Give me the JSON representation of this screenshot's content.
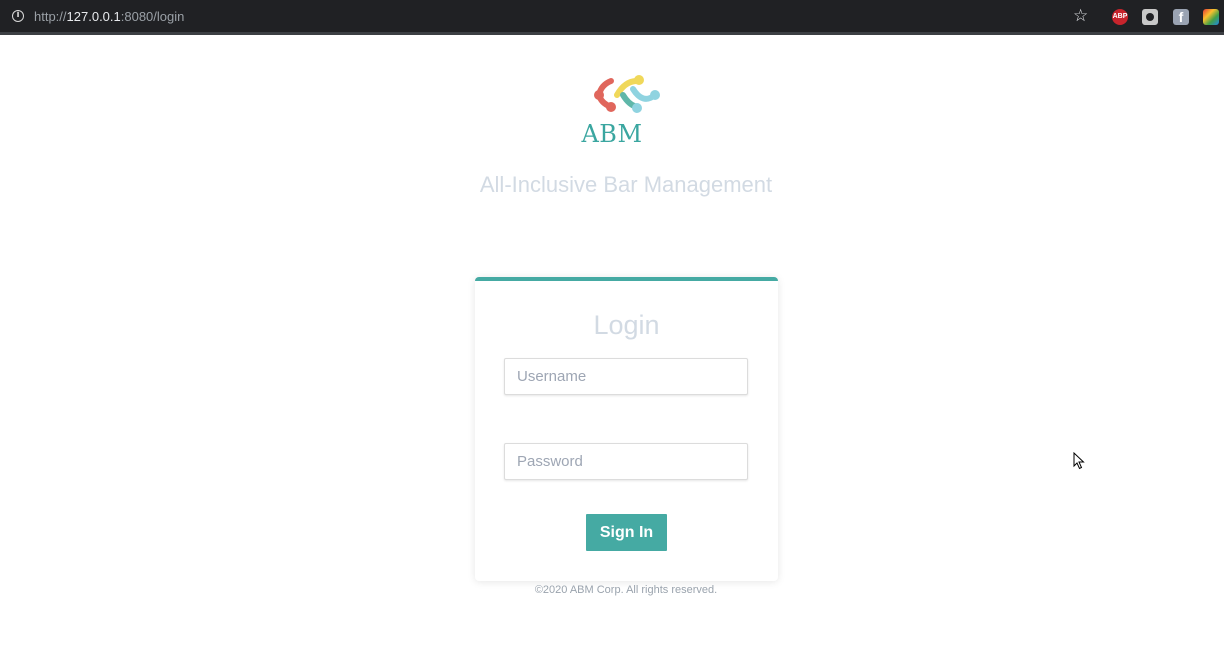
{
  "browser": {
    "url_scheme": "http://",
    "url_host": "127.0.0.1",
    "url_path": ":8080/login",
    "icons": [
      "info-icon",
      "star-icon",
      "adblock-extension-icon",
      "camera-extension-icon",
      "facebook-extension-icon",
      "multicolor-extension-icon"
    ],
    "abp_label": "ABP",
    "facebook_label": "f"
  },
  "brand": {
    "name": "ABM",
    "tagline": "All-Inclusive Bar Management",
    "logo_colors": [
      "#e0665c",
      "#f0d85a",
      "#8fd3e0",
      "#5fb7a9"
    ],
    "accent": "#45aaa3"
  },
  "login": {
    "title": "Login",
    "username_placeholder": "Username",
    "password_placeholder": "Password",
    "submit_label": "Sign In"
  },
  "footer": {
    "copyright": "©2020 ABM Corp. All rights reserved."
  }
}
